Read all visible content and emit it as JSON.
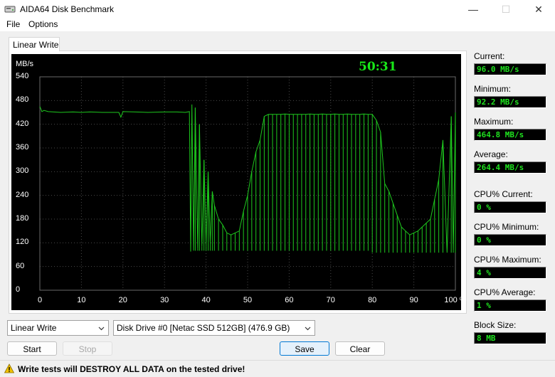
{
  "window": {
    "title": "AIDA64 Disk Benchmark",
    "icon": "aida64-app-icon",
    "controls": {
      "minimize": "—",
      "maximize": "☐",
      "close": "✕"
    }
  },
  "menu": [
    "File",
    "Options"
  ],
  "tab": {
    "label": "Linear Write"
  },
  "chart": {
    "units_label": "MB/s",
    "elapsed": "50:31",
    "background": "#000000",
    "line_color": "#1ec81e",
    "grid_color": "#4a4a4a",
    "y_ticks": [
      "540",
      "480",
      "420",
      "360",
      "300",
      "240",
      "180",
      "120",
      "60",
      "0"
    ],
    "x_ticks": [
      "0",
      "10",
      "20",
      "30",
      "40",
      "50",
      "60",
      "70",
      "80",
      "90",
      "100 %"
    ]
  },
  "chart_data": {
    "type": "line",
    "title": "",
    "xlabel": "",
    "ylabel": "MB/s",
    "xlim": [
      0,
      100
    ],
    "ylim": [
      0,
      540
    ],
    "grid": true,
    "series": [
      {
        "description": "Write speed over disk position",
        "x": [
          0,
          0.5,
          1,
          2,
          5,
          8,
          10,
          12,
          15,
          19,
          19.5,
          20,
          23,
          26,
          30,
          33,
          35,
          36,
          36.3,
          36.6,
          37,
          37.4,
          38,
          38.4,
          39,
          39.5,
          40,
          40.5,
          41,
          41.5,
          42,
          43,
          44,
          45,
          46,
          47,
          48,
          49,
          50,
          51,
          52,
          53,
          54,
          55,
          56,
          57,
          58,
          59,
          60,
          61,
          62,
          63,
          64,
          65,
          66,
          67,
          68,
          69,
          70,
          71,
          72,
          73,
          74,
          75,
          76,
          77,
          78,
          79,
          80,
          81,
          82,
          83,
          84,
          85,
          86,
          87,
          88,
          89,
          90,
          91,
          92,
          93,
          94,
          95,
          96,
          97,
          98,
          99,
          99.5,
          100
        ],
        "y": [
          465,
          452,
          455,
          452,
          450,
          451,
          450,
          451,
          450,
          450,
          438,
          452,
          451,
          450,
          451,
          451,
          450,
          452,
          98,
          470,
          100,
          462,
          105,
          420,
          110,
          330,
          115,
          300,
          120,
          250,
          215,
          180,
          165,
          145,
          140,
          145,
          150,
          200,
          240,
          300,
          350,
          380,
          440,
          445,
          445,
          445,
          445,
          446,
          445,
          445,
          445,
          445,
          445,
          446,
          445,
          445,
          446,
          445,
          445,
          446,
          445,
          445,
          446,
          445,
          445,
          445,
          446,
          445,
          445,
          430,
          400,
          270,
          250,
          220,
          190,
          160,
          150,
          140,
          145,
          150,
          160,
          170,
          180,
          230,
          280,
          380,
          95,
          440,
          100,
          450
        ]
      }
    ]
  },
  "stats": [
    {
      "label": "Current:",
      "value": "96.0 MB/s"
    },
    {
      "label": "Minimum:",
      "value": "92.2 MB/s"
    },
    {
      "label": "Maximum:",
      "value": "464.8 MB/s"
    },
    {
      "label": "Average:",
      "value": "264.4 MB/s"
    },
    {
      "label": "CPU% Current:",
      "value": "0 %"
    },
    {
      "label": "CPU% Minimum:",
      "value": "0 %"
    },
    {
      "label": "CPU% Maximum:",
      "value": "4 %"
    },
    {
      "label": "CPU% Average:",
      "value": "1 %"
    },
    {
      "label": "Block Size:",
      "value": "8 MB"
    }
  ],
  "controls": {
    "test_select": "Linear Write",
    "drive_select": "Disk Drive #0  [Netac SSD 512GB]  (476.9 GB)",
    "start": "Start",
    "stop": "Stop",
    "save": "Save",
    "clear": "Clear"
  },
  "status": {
    "icon": "warning-icon",
    "message": "Write tests will DESTROY ALL DATA on the tested drive!"
  }
}
